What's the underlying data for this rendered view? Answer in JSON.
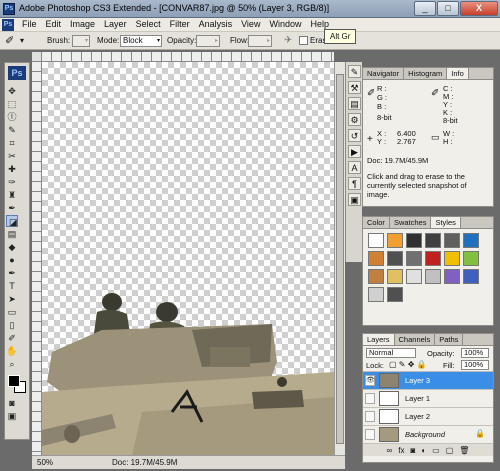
{
  "window": {
    "title": "Adobe Photoshop CS3 Extended - [CONVAR87.jpg @ 50% (Layer 3, RGB/8)]",
    "app_icon": "Ps",
    "min": "_",
    "max": "□",
    "close": "X"
  },
  "menu": {
    "items": [
      "File",
      "Edit",
      "Image",
      "Layer",
      "Select",
      "Filter",
      "Analysis",
      "View",
      "Window",
      "Help"
    ]
  },
  "options": {
    "brush_label": "Brush:",
    "mode_label": "Mode:",
    "mode_value": "Block",
    "opacity_label": "Opacity:",
    "flow_label": "Flow:",
    "erase_label": "Erase",
    "tooltip": "Alt Gr"
  },
  "toolbox": {
    "logo": "Ps",
    "tools": [
      "move-icon",
      "marquee-icon",
      "lasso-icon",
      "quick-select-icon",
      "crop-icon",
      "slice-icon",
      "healing-icon",
      "brush-icon",
      "stamp-icon",
      "history-brush-icon",
      "eraser-icon",
      "gradient-icon",
      "blur-icon",
      "dodge-icon",
      "pen-icon",
      "type-icon",
      "path-select-icon",
      "shape-icon",
      "notes-icon",
      "eyedropper-icon",
      "hand-icon",
      "zoom-icon"
    ],
    "foreground": "#000000",
    "background": "#ffffff"
  },
  "status": {
    "zoom": "50%",
    "doc": "Doc: 19.7M/45.9M"
  },
  "info_panel": {
    "tabs": [
      "Navigator",
      "Histogram",
      "Info"
    ],
    "active_tab": "Info",
    "r": "R :",
    "g": "G :",
    "b": "B :",
    "c": "C :",
    "m": "M :",
    "y": "Y :",
    "k": "K :",
    "bit_left": "8-bit",
    "bit_right": "8-bit",
    "x_label": "X :",
    "x_value": "6.400",
    "y_label": "Y :",
    "y_value": "2.767",
    "w_label": "W :",
    "h_label": "H :",
    "doc": "Doc: 19.7M/45.9M",
    "hint": "Click and drag to erase to the currently selected snapshot of image."
  },
  "styles_panel": {
    "tabs": [
      "Color",
      "Swatches",
      "Styles"
    ],
    "active_tab": "Styles",
    "swatches": [
      "#ffffff",
      "#f0a030",
      "#303030",
      "#404040",
      "#606060",
      "#2070c0",
      "#d08030",
      "#505050",
      "#707070",
      "#c02020",
      "#f0c000",
      "#80c040",
      "#c08040",
      "#e0c060",
      "#e0e0e0",
      "#c0c0c0",
      "#8060c0",
      "#4060c0",
      "#d0d0d0",
      "#505050"
    ]
  },
  "layers_panel": {
    "tabs": [
      "Layers",
      "Channels",
      "Paths"
    ],
    "active_tab": "Layers",
    "blend": "Normal",
    "opacity_label": "Opacity:",
    "opacity_value": "100%",
    "lock_label": "Lock:",
    "fill_label": "Fill:",
    "fill_value": "100%",
    "layers": [
      {
        "name": "Layer 3",
        "active": true
      },
      {
        "name": "Layer 1",
        "active": false
      },
      {
        "name": "Layer 2",
        "active": false
      },
      {
        "name": "Background",
        "active": false
      }
    ]
  }
}
